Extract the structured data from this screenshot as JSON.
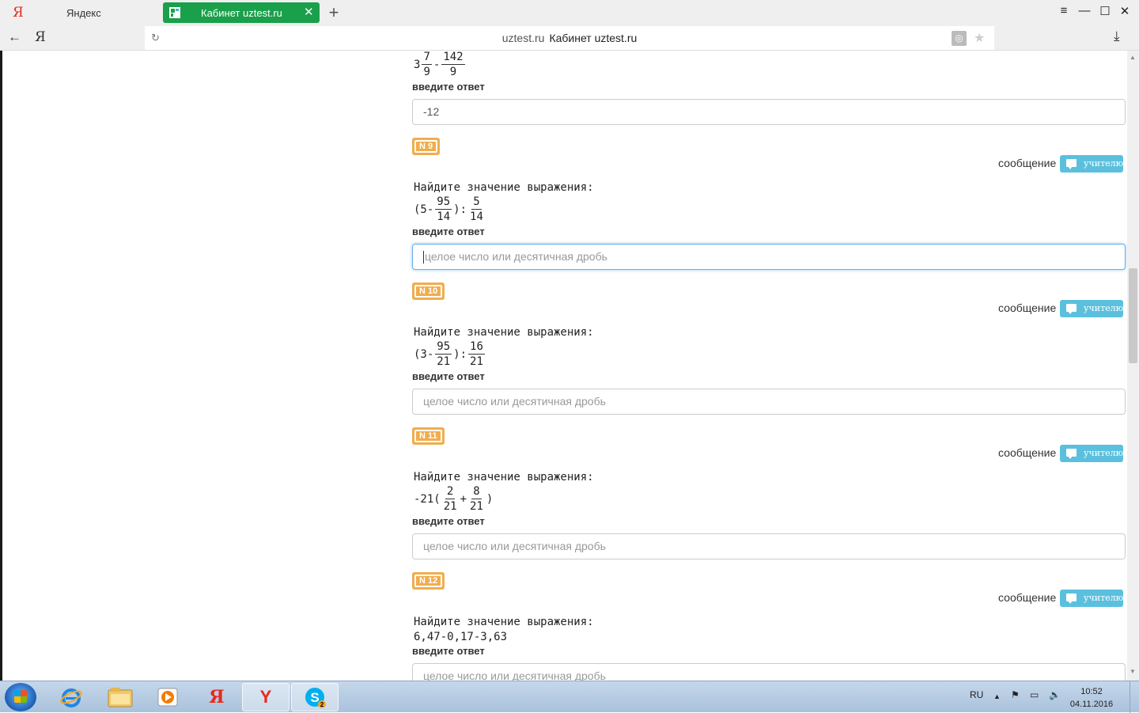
{
  "browser": {
    "tabs": [
      {
        "logo": "Я",
        "label": "Яндекс"
      },
      {
        "label": "Кабинет uztest.ru",
        "close": "✕"
      }
    ],
    "new_tab": "+",
    "window_controls": {
      "menu": "≡",
      "minimize": "—",
      "maximize": "☐",
      "close": "✕"
    },
    "address": {
      "host": "uztest.ru",
      "title": "Кабинет uztest.ru"
    },
    "nav": {
      "back": "←",
      "ya": "Я",
      "reload": "↻",
      "star": "★",
      "download": "⤓"
    }
  },
  "page": {
    "prev_question": {
      "expression": {
        "whole": "3",
        "frac1": {
          "num": "7",
          "den": "9"
        },
        "op": "-",
        "frac2": {
          "num": "142",
          "den": "9"
        }
      },
      "answer_label": "введите ответ",
      "answer_value": "-12"
    },
    "questions": [
      {
        "badge": "N 9",
        "message_label": "сообщение",
        "message_button": "учителю",
        "title": "Найдите значение выражения:",
        "expression": {
          "open": "(5-",
          "frac1": {
            "num": "95",
            "den": "14"
          },
          "mid": "):",
          "frac2": {
            "num": "5",
            "den": "14"
          }
        },
        "answer_label": "введите ответ",
        "placeholder": "целое число или десятичная дробь",
        "focused": true
      },
      {
        "badge": "N 10",
        "message_label": "сообщение",
        "message_button": "учителю",
        "title": "Найдите значение выражения:",
        "expression": {
          "open": "(3-",
          "frac1": {
            "num": "95",
            "den": "21"
          },
          "mid": "):",
          "frac2": {
            "num": "16",
            "den": "21"
          }
        },
        "answer_label": "введите ответ",
        "placeholder": "целое число или десятичная дробь"
      },
      {
        "badge": "N 11",
        "message_label": "сообщение",
        "message_button": "учителю",
        "title": "Найдите значение выражения:",
        "expression": {
          "open": "-21(",
          "frac1": {
            "num": "2",
            "den": "21"
          },
          "mid": "+",
          "frac2": {
            "num": "8",
            "den": "21"
          },
          "close": ")"
        },
        "answer_label": "введите ответ",
        "placeholder": "целое число или десятичная дробь"
      },
      {
        "badge": "N 12",
        "message_label": "сообщение",
        "message_button": "учителю",
        "title": "Найдите значение выражения:",
        "expression_text": "6,47-0,17-3,63",
        "answer_label": "введите ответ",
        "placeholder": "целое число или десятичная дробь"
      }
    ]
  },
  "taskbar": {
    "icons": [
      "windows-start",
      "internet-explorer",
      "file-explorer",
      "media-player",
      "yandex-browser-inactive",
      "yandex-browser",
      "skype"
    ],
    "ya_glyph": "Я",
    "y_glyph": "Y",
    "skype_glyph": "S",
    "skype_count": "2",
    "lang": "RU",
    "time": "10:52",
    "date": "04.11.2016"
  },
  "colors": {
    "tab_active": "#1a9f4b",
    "badge": "#f0ad4e",
    "message_button": "#5bc0de",
    "focus": "#66afe9"
  }
}
